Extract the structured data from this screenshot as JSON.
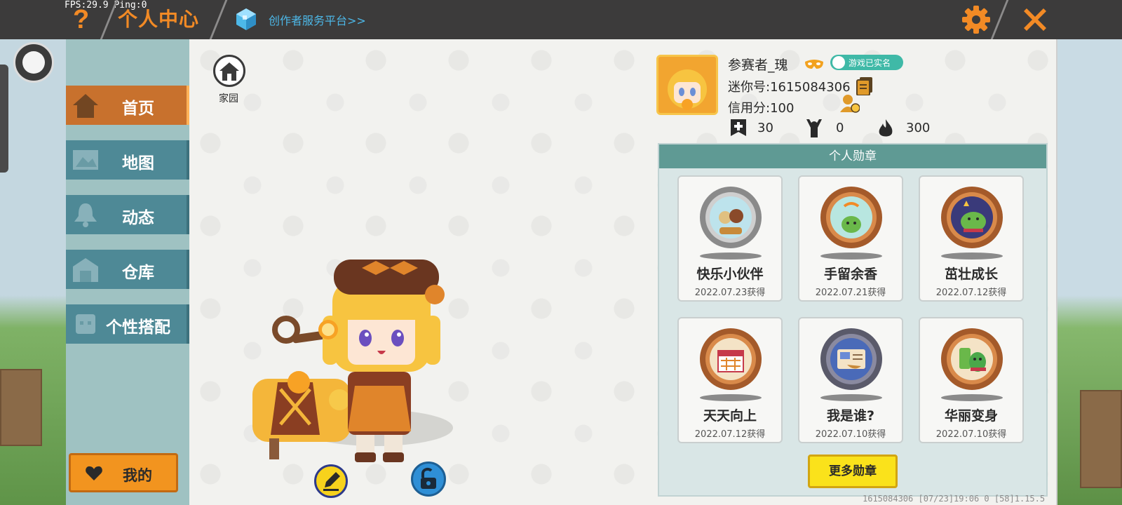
{
  "debug": {
    "fps": "FPS:29.9",
    "ping": "Ping:0"
  },
  "header": {
    "title": "个人中心",
    "platform_link": "创作者服务平台>>",
    "help_icon": "help-icon",
    "settings_icon": "gear-icon",
    "close_icon": "close-icon"
  },
  "sidebar": {
    "items": [
      {
        "label": "首页",
        "icon": "home-icon",
        "active": true
      },
      {
        "label": "地图",
        "icon": "map-icon",
        "active": false
      },
      {
        "label": "动态",
        "icon": "bell-icon",
        "active": false
      },
      {
        "label": "仓库",
        "icon": "warehouse-icon",
        "active": false
      },
      {
        "label": "个性搭配",
        "icon": "outfit-icon",
        "active": false
      }
    ],
    "mine_label": "我的"
  },
  "home": {
    "label": "家园"
  },
  "profile": {
    "name": "参赛者_瑰",
    "verified_label": "游戏已实名",
    "mini_id": "迷你号:1615084306",
    "credit": "信用分:100",
    "stats": [
      {
        "icon": "plus-icon",
        "value": "30"
      },
      {
        "icon": "cheer-icon",
        "value": "0"
      },
      {
        "icon": "fire-icon",
        "value": "300"
      }
    ]
  },
  "badges": {
    "title": "个人勋章",
    "items": [
      {
        "name": "快乐小伙伴",
        "date": "2022.07.23获得"
      },
      {
        "name": "手留余香",
        "date": "2022.07.21获得"
      },
      {
        "name": "茁壮成长",
        "date": "2022.07.12获得"
      },
      {
        "name": "天天向上",
        "date": "2022.07.12获得"
      },
      {
        "name": "我是谁?",
        "date": "2022.07.10获得"
      },
      {
        "name": "华丽变身",
        "date": "2022.07.10获得"
      }
    ],
    "more_label": "更多勋章"
  },
  "footer": {
    "info": "1615084306 [07/23]19:06 0 [58]1.15.5"
  },
  "colors": {
    "accent_orange": "#f28a25",
    "nav_teal": "#4e8996",
    "nav_active": "#c8712d",
    "badge_header": "#5f9a94",
    "more_button": "#fae21b"
  }
}
